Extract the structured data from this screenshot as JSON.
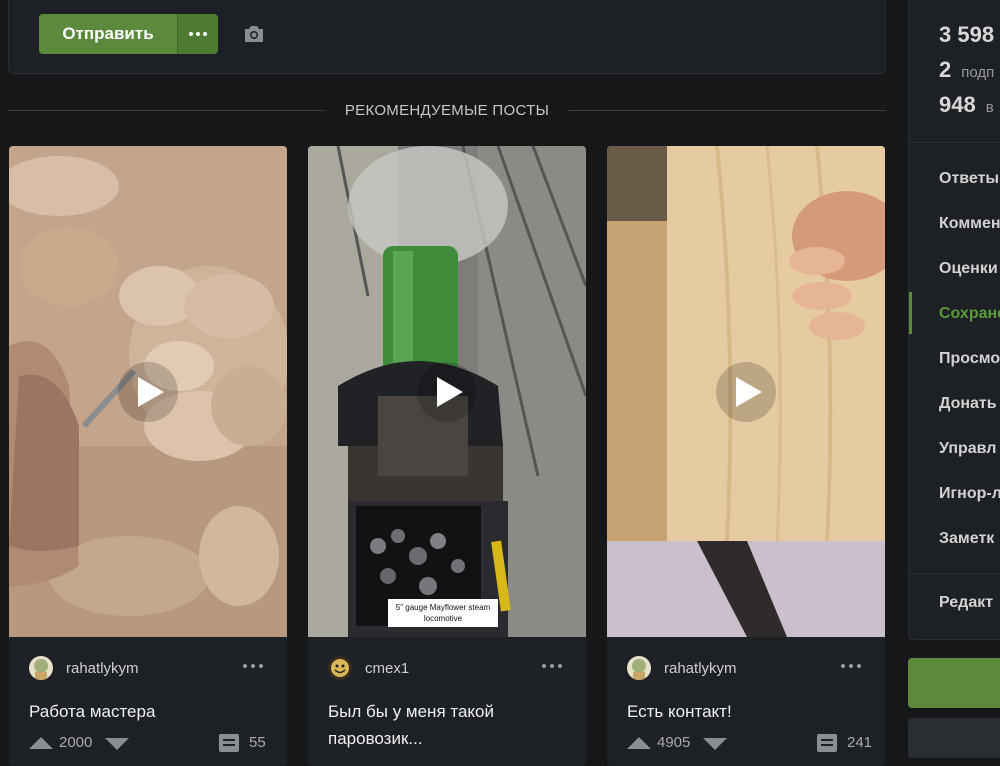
{
  "composer": {
    "send_label": "Отправить"
  },
  "section": {
    "title": "РЕКОМЕНДУЕМЫЕ ПОСТЫ"
  },
  "posts": [
    {
      "author": "rahatlykym",
      "title": "Работа мастера",
      "rating": "2000",
      "comments": "55"
    },
    {
      "author": "cmex1",
      "title": "Был бы у меня такой паровозик...",
      "caption": "5\" gauge Mayflower steam locomotive",
      "rating": "",
      "comments": ""
    },
    {
      "author": "rahatlykym",
      "title": "Есть контакт!",
      "rating": "4905",
      "comments": "241"
    }
  ],
  "sidebar": {
    "stats": [
      {
        "value": "3 598",
        "label": ""
      },
      {
        "value": "2",
        "label": "подп"
      },
      {
        "value": "948",
        "label": "в"
      }
    ],
    "menu": [
      "Ответы",
      "Коммен",
      "Оценки",
      "Сохране",
      "Просмо",
      "Донать",
      "Управл",
      "Игнор-л",
      "Заметк"
    ],
    "edit_label": "Редакт"
  },
  "colors": {
    "accent": "#5b8a3c",
    "background": "#151719",
    "panel": "#1d2024"
  }
}
